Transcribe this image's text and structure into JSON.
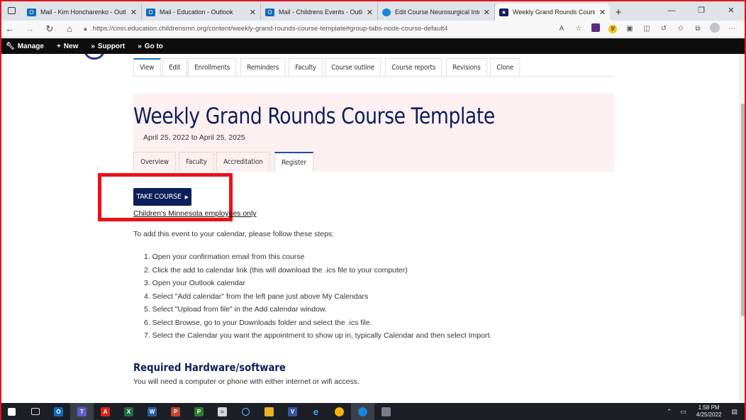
{
  "browser": {
    "tabs": [
      {
        "label": "Mail - Kim Honcharenko - Outlo",
        "favicon": "outlook-icon",
        "active": false
      },
      {
        "label": "Mail - Education - Outlook",
        "favicon": "outlook-icon",
        "active": false
      },
      {
        "label": "Mail - Childrens Events - Outloo",
        "favicon": "outlook-icon",
        "active": false
      },
      {
        "label": "Edit Course Neurosurgical Interv",
        "favicon": "edge-icon",
        "active": false
      },
      {
        "label": "Weekly Grand Rounds Course Te",
        "favicon": "star-icon",
        "active": true
      }
    ],
    "url": "https://cmn.education.childrensmn.org/content/weekly-grand-rounds-course-template#group-tabs-node-course-default4"
  },
  "admin_toolbar": {
    "manage": "Manage",
    "new": "New",
    "support": "Support",
    "goto": "Go to"
  },
  "admin_tabs": [
    "View",
    "Edit",
    "Enrollments",
    "Reminders",
    "Faculty",
    "Course outline",
    "Course reports",
    "Revisions",
    "Clone"
  ],
  "course": {
    "title": "Weekly Grand Rounds Course Template",
    "dates": "April 25, 2022 to April 25, 2025"
  },
  "sub_tabs": [
    "Overview",
    "Faculty",
    "Accreditation",
    "Register"
  ],
  "register": {
    "take_course": "TAKE COURSE",
    "employees_only": "Children's Minnesota employees only",
    "intro": "To add this event to your calendar, please follow these steps:",
    "steps": [
      "1. Open your confirmation email from this course",
      "2. Click the add to calendar link (this will download the .ics file to your computer)",
      "3. Open your Outlook calendar",
      "4. Select \"Add calendar\" from the left pane just above My Calendars",
      "5. Select \"Upload from file\" in the Add calendar window.",
      "6. Select Browse, go to your Downloads folder and select the .ics file.",
      "7. Select the Calendar you want the appointment to show up in, typically Calendar and then select Import."
    ],
    "req_heading": "Required Hardware/software",
    "req_text": "You will need a computer or phone with either internet or wifi access."
  },
  "taskbar": {
    "time": "1:58 PM",
    "date": "4/25/2022"
  },
  "colors": {
    "navy": "#0c1f5b",
    "highlight_red": "#ee0f17",
    "hero_bg": "#fdf0f0"
  }
}
